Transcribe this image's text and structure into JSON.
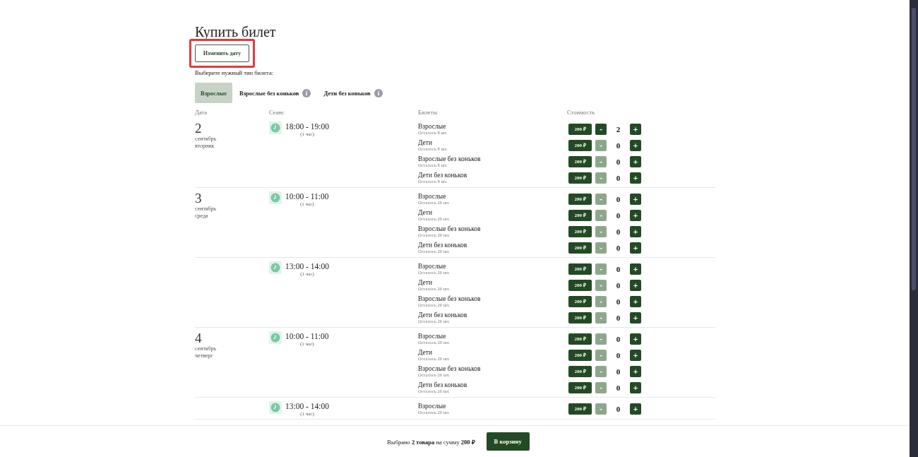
{
  "title": "Купить билет",
  "change_date_button": {
    "label": "Изменить дату",
    "highlighted": true
  },
  "counter_symbols": {
    "minus": "-",
    "plus": "+"
  },
  "ticket_type_prompt": "Выберите нужный тип билета:",
  "tabs": [
    {
      "label": "Взрослые",
      "selected": true,
      "info": false
    },
    {
      "label": "Взрослые без коньков",
      "selected": false,
      "info": true
    },
    {
      "label": "Дети без коньков",
      "selected": false,
      "info": true
    }
  ],
  "columns": [
    "Дата",
    "Сеанс",
    "Билеты",
    "Стоимость"
  ],
  "sessions": [
    {
      "day": "2",
      "month": "сентябрь",
      "weekday": "вторник",
      "time": "18:00 - 19:00",
      "duration": "(1 час)",
      "tickets": [
        {
          "name": "Взрослые",
          "remaining": "Осталось 8 шт.",
          "price": "200 ₽",
          "count": "2",
          "minus_disabled": false
        },
        {
          "name": "Дети",
          "remaining": "Осталось 8 шт.",
          "price": "200 ₽",
          "count": "0",
          "minus_disabled": true
        },
        {
          "name": "Взрослые без коньков",
          "remaining": "Осталось 8 шт.",
          "price": "200 ₽",
          "count": "0",
          "minus_disabled": true
        },
        {
          "name": "Дети без коньков",
          "remaining": "Осталось 8 шт.",
          "price": "200 ₽",
          "count": "0",
          "minus_disabled": true
        }
      ]
    },
    {
      "day": "3",
      "month": "сентябрь",
      "weekday": "среда",
      "time": "10:00 - 11:00",
      "duration": "(1 час)",
      "tickets": [
        {
          "name": "Взрослые",
          "remaining": "Осталось 20 шт.",
          "price": "200 ₽",
          "count": "0",
          "minus_disabled": true
        },
        {
          "name": "Дети",
          "remaining": "Осталось 20 шт.",
          "price": "200 ₽",
          "count": "0",
          "minus_disabled": true
        },
        {
          "name": "Взрослые без коньков",
          "remaining": "Осталось 20 шт.",
          "price": "200 ₽",
          "count": "0",
          "minus_disabled": true
        },
        {
          "name": "Дети без коньков",
          "remaining": "Осталось 20 шт.",
          "price": "200 ₽",
          "count": "0",
          "minus_disabled": true
        }
      ]
    },
    {
      "time": "13:00 - 14:00",
      "duration": "(1 час)",
      "tickets": [
        {
          "name": "Взрослые",
          "remaining": "Осталось 20 шт.",
          "price": "200 ₽",
          "count": "0",
          "minus_disabled": true
        },
        {
          "name": "Дети",
          "remaining": "Осталось 20 шт.",
          "price": "200 ₽",
          "count": "0",
          "minus_disabled": true
        },
        {
          "name": "Взрослые без коньков",
          "remaining": "Осталось 20 шт.",
          "price": "200 ₽",
          "count": "0",
          "minus_disabled": true
        },
        {
          "name": "Дети без коньков",
          "remaining": "Осталось 20 шт.",
          "price": "200 ₽",
          "count": "0",
          "minus_disabled": true
        }
      ]
    },
    {
      "day": "4",
      "month": "сентябрь",
      "weekday": "четверг",
      "time": "10:00 - 11:00",
      "duration": "(1 час)",
      "tickets": [
        {
          "name": "Взрослые",
          "remaining": "Осталось 20 шт.",
          "price": "200 ₽",
          "count": "0",
          "minus_disabled": true
        },
        {
          "name": "Дети",
          "remaining": "Осталось 20 шт.",
          "price": "200 ₽",
          "count": "0",
          "minus_disabled": true
        },
        {
          "name": "Взрослые без коньков",
          "remaining": "Осталось 20 шт.",
          "price": "200 ₽",
          "count": "0",
          "minus_disabled": true
        },
        {
          "name": "Дети без коньков",
          "remaining": "Осталось 20 шт.",
          "price": "200 ₽",
          "count": "0",
          "minus_disabled": true
        }
      ]
    },
    {
      "time": "13:00 - 14:00",
      "duration": "(1 час)",
      "tickets": [
        {
          "name": "Взрослые",
          "remaining": "Осталось 20 шт.",
          "price": "200 ₽",
          "count": "0",
          "minus_disabled": true
        }
      ]
    }
  ],
  "cart_bar": {
    "summary": "Выбрано **2 товара** на сумму **200  ₽**",
    "button": "В корзину"
  }
}
